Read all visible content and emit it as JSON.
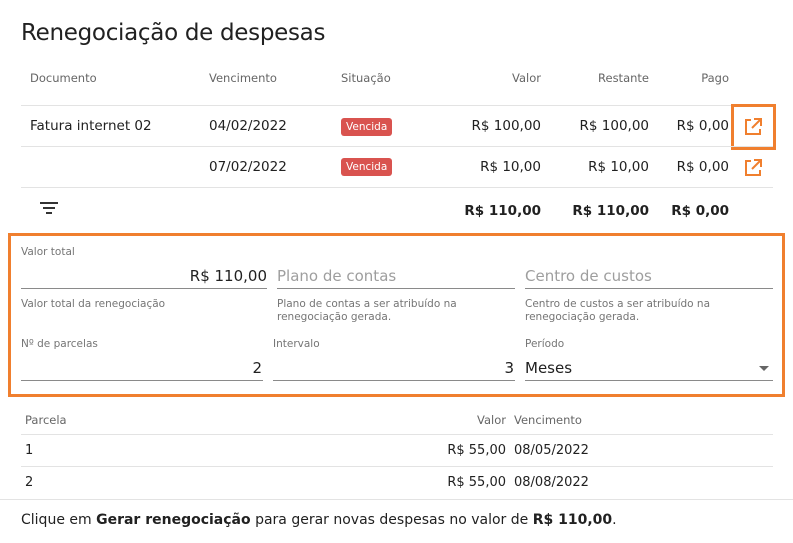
{
  "title": "Renegociação de despesas",
  "table": {
    "headers": {
      "documento": "Documento",
      "vencimento": "Vencimento",
      "situacao": "Situação",
      "valor": "Valor",
      "restante": "Restante",
      "pago": "Pago"
    },
    "rows": [
      {
        "documento": "Fatura internet 02",
        "vencimento": "04/02/2022",
        "situacao": "Vencida",
        "valor": "R$ 100,00",
        "restante": "R$ 100,00",
        "pago": "R$ 0,00"
      },
      {
        "documento": "",
        "vencimento": "07/02/2022",
        "situacao": "Vencida",
        "valor": "R$ 10,00",
        "restante": "R$ 10,00",
        "pago": "R$ 0,00"
      }
    ],
    "totals": {
      "valor": "R$ 110,00",
      "restante": "R$ 110,00",
      "pago": "R$ 0,00"
    }
  },
  "form": {
    "valor_total": {
      "label": "Valor total",
      "value": "R$ 110,00",
      "help": "Valor total da renegociação"
    },
    "plano_contas": {
      "placeholder": "Plano de contas",
      "help_1": "Plano de contas a ser atribuído na",
      "help_2": "renegociação gerada."
    },
    "centro_custos": {
      "placeholder": "Centro de custos",
      "help_1": "Centro de custos a ser atribuído na",
      "help_2": "renegociação gerada."
    },
    "parcelas": {
      "label": "Nº de parcelas",
      "value": "2"
    },
    "intervalo": {
      "label": "Intervalo",
      "value": "3"
    },
    "periodo": {
      "label": "Período",
      "value": "Meses"
    }
  },
  "installments": {
    "headers": {
      "parcela": "Parcela",
      "valor": "Valor",
      "vencimento": "Vencimento"
    },
    "rows": [
      {
        "parcela": "1",
        "valor": "R$ 55,00",
        "vencimento": "08/05/2022"
      },
      {
        "parcela": "2",
        "valor": "R$ 55,00",
        "vencimento": "08/08/2022"
      }
    ]
  },
  "footer": {
    "prefix": "Clique em ",
    "action": "Gerar renegociação",
    "middle": " para gerar novas despesas no valor de ",
    "amount": "R$ 110,00",
    "suffix": "."
  },
  "colors": {
    "accent": "#f07f2e",
    "badge": "#d9534f"
  }
}
